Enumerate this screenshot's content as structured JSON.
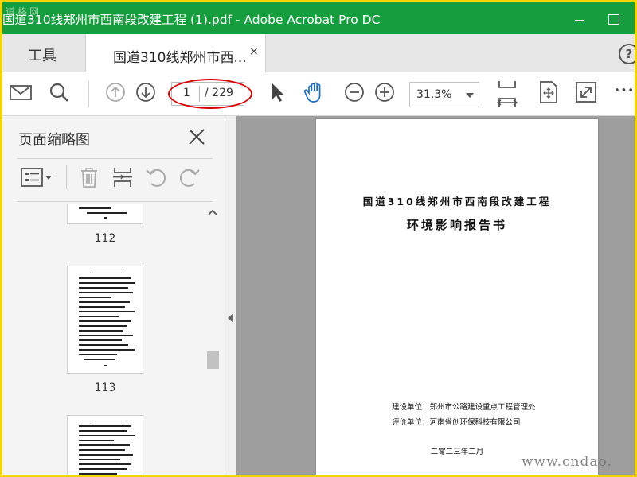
{
  "window": {
    "title": "国道310线郑州市西南段改建工程 (1).pdf - Adobe Acrobat Pro DC",
    "watermark_top": "道格网"
  },
  "tabs": {
    "tools_label": "工具",
    "doc_label": "国道310线郑州市西...",
    "close_glyph": "×",
    "help_glyph": "?"
  },
  "toolbar": {
    "current_page": "1",
    "total_pages": "/ 229",
    "zoom": "31.3%",
    "more_glyph": "•••"
  },
  "side_panel": {
    "title": "页面缩略图",
    "thumbnails": [
      {
        "label": "112"
      },
      {
        "label": "113"
      },
      {
        "label": ""
      }
    ]
  },
  "document": {
    "title_line1": "国道310线郑州市西南段改建工程",
    "title_line2": "环境影响报告书",
    "builder": "建设单位：郑州市公路建设重点工程管理处",
    "evaluator": "评价单位：河南省创环保科技有限公司",
    "date": "二零二三年二月"
  },
  "watermark": "www.cndao."
}
